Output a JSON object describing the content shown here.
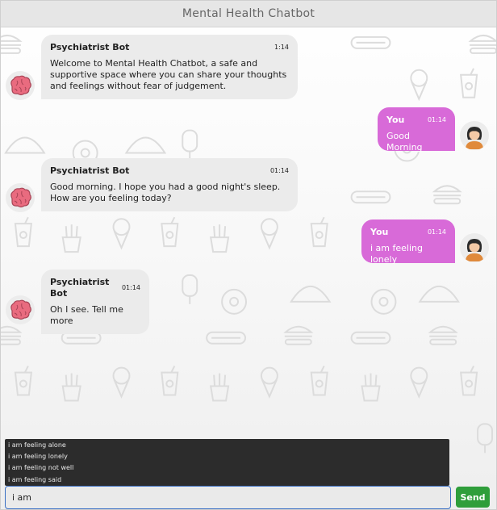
{
  "app": {
    "title": "Mental Health Chatbot"
  },
  "messages": [
    {
      "role": "bot",
      "sender": "Psychiatrist Bot",
      "time": "1:14",
      "text": "Welcome to Mental Health Chatbot, a safe and supportive space where you can share your thoughts and feelings without fear of judgement.",
      "avatar": "brain-icon"
    },
    {
      "role": "user",
      "sender": "You",
      "time": "01:14",
      "text": "Good Morning",
      "avatar": "user-avatar-icon"
    },
    {
      "role": "bot",
      "sender": "Psychiatrist Bot",
      "time": "01:14",
      "text": "Good morning. I hope you had a good night's sleep. How are you feeling today?",
      "avatar": "brain-icon"
    },
    {
      "role": "user",
      "sender": "You",
      "time": "01:14",
      "text": "i am feeling lonely",
      "avatar": "user-avatar-icon"
    },
    {
      "role": "bot",
      "sender": "Psychiatrist Bot",
      "time": "01:14",
      "text": "Oh I see. Tell me more",
      "avatar": "brain-icon"
    }
  ],
  "autocomplete": {
    "options": [
      "i am feeling alone",
      "i am feeling lonely",
      "i am feeling not well",
      "i am feeling said"
    ]
  },
  "composer": {
    "input_value": "i am",
    "send_label": "Send"
  },
  "colors": {
    "user_bubble": "#d86ad8",
    "bot_bubble": "#ebebeb",
    "send_button": "#2f9e3b",
    "input_border": "#3a6fc4"
  }
}
